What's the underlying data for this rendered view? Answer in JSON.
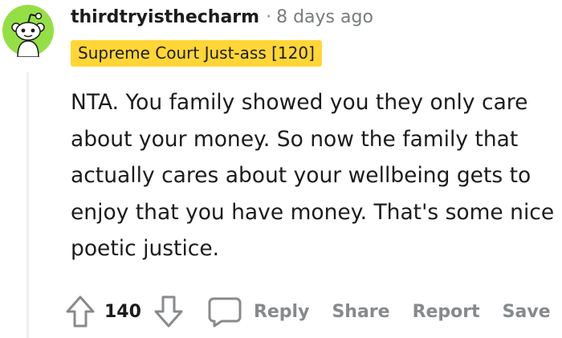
{
  "comment": {
    "username": "thirdtryisthecharm",
    "separator": "·",
    "timestamp": "8 days ago",
    "flair": "Supreme Court Just-ass [120]",
    "body": "NTA. You family showed you they only care about your money. So now the family that actually cares about your wellbeing gets to enjoy that you have money. That's some nice poetic justice.",
    "score": "140"
  },
  "actions": {
    "reply_label": "Reply",
    "share_label": "Share",
    "report_label": "Report",
    "save_label": "Save"
  },
  "colors": {
    "avatar_bg": "#94e044",
    "flair_bg": "#ffd635",
    "muted_text": "#878a8c",
    "text": "#1c1c1c",
    "thread_line": "#edeff1"
  },
  "icons": {
    "avatar": "reddit-snoo-avatar",
    "upvote": "arrow-up-outline",
    "downvote": "arrow-down-outline",
    "reply": "speech-bubble-outline"
  }
}
